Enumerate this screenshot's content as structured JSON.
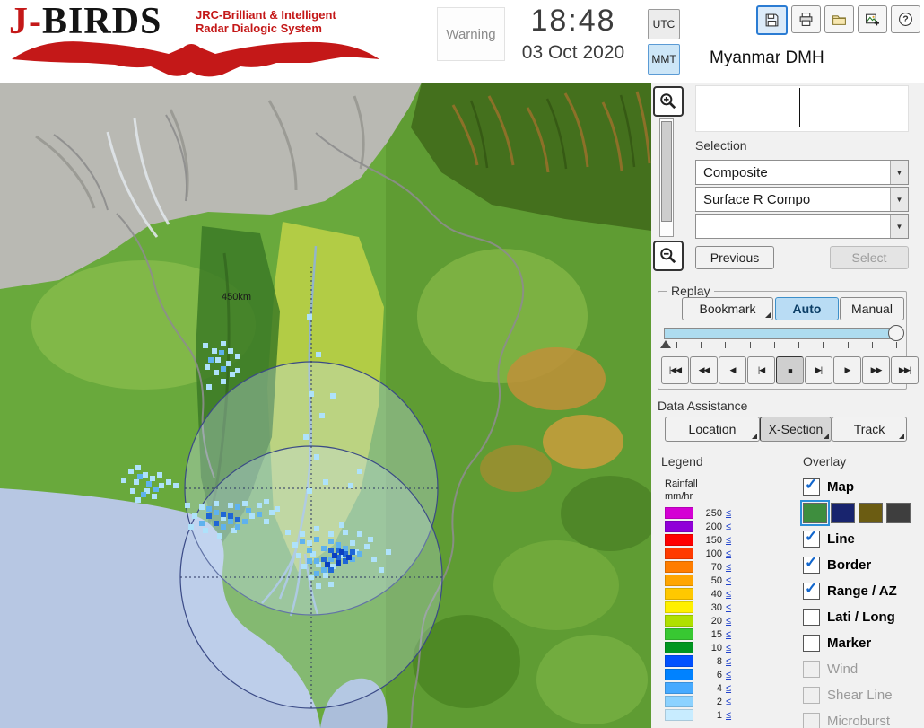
{
  "brand": {
    "logo_red_color": "#c41818",
    "accent_blue": "#2b7cd3"
  },
  "header": {
    "logo_title_red": "J-",
    "logo_title_dark": "BIRDS",
    "logo_sub1": "JRC-Brilliant & Intelligent",
    "logo_sub2": "Radar  Dialogic  System",
    "warning_label": "Warning",
    "time": "18:48",
    "date": "03 Oct 2020",
    "utc_label": "UTC",
    "mmt_label": "MMT",
    "timezone_selected": "MMT",
    "station_title": "Myanmar DMH"
  },
  "toolbar": {
    "icons": [
      "save",
      "print",
      "folder-open",
      "export-image",
      "help"
    ]
  },
  "selection": {
    "label": "Selection",
    "combo1": "Composite",
    "combo2": "Surface R Compo",
    "combo3": "",
    "previous": "Previous",
    "select": "Select"
  },
  "replay": {
    "title": "Replay",
    "bookmark": "Bookmark",
    "auto": "Auto",
    "manual": "Manual",
    "mode_selected": "Auto",
    "slider_position": "100%",
    "playback": [
      "|◀◀",
      "◀◀",
      "◀",
      "|◀",
      "■",
      "▶|",
      "▶",
      "▶▶",
      "▶▶|"
    ],
    "playback_pressed": "■"
  },
  "data_assistance": {
    "label": "Data Assistance",
    "location": "Location",
    "xsection": "X-Section",
    "track": "Track",
    "pressed": "X-Section"
  },
  "legend": {
    "title": "Legend",
    "unit1": "Rainfall",
    "unit2": "mm/hr",
    "lte": "≤",
    "rows": [
      {
        "value": "250",
        "color": "#d400d4"
      },
      {
        "value": "200",
        "color": "#9000d8"
      },
      {
        "value": "150",
        "color": "#ff0000"
      },
      {
        "value": "100",
        "color": "#ff3a00"
      },
      {
        "value": "70",
        "color": "#ff7d00"
      },
      {
        "value": "50",
        "color": "#ffa500"
      },
      {
        "value": "40",
        "color": "#ffc800"
      },
      {
        "value": "30",
        "color": "#fff000"
      },
      {
        "value": "20",
        "color": "#b0e000"
      },
      {
        "value": "15",
        "color": "#38c832"
      },
      {
        "value": "10",
        "color": "#009620"
      },
      {
        "value": "8",
        "color": "#0050ff"
      },
      {
        "value": "6",
        "color": "#0082ff"
      },
      {
        "value": "4",
        "color": "#46aaff"
      },
      {
        "value": "2",
        "color": "#8cd2ff"
      },
      {
        "value": "1",
        "color": "#c8ecff"
      }
    ]
  },
  "overlay": {
    "title": "Overlay",
    "items": [
      {
        "label": "Map",
        "checked": true,
        "disabled": false
      },
      {
        "label": "Line",
        "checked": true,
        "disabled": false
      },
      {
        "label": "Border",
        "checked": true,
        "disabled": false
      },
      {
        "label": "Range / AZ",
        "checked": true,
        "disabled": false
      },
      {
        "label": "Lati / Long",
        "checked": false,
        "disabled": false
      },
      {
        "label": "Marker",
        "checked": false,
        "disabled": false
      },
      {
        "label": "Wind",
        "checked": false,
        "disabled": true
      },
      {
        "label": "Shear Line",
        "checked": false,
        "disabled": true
      },
      {
        "label": "Microburst",
        "checked": false,
        "disabled": true
      }
    ],
    "map_styles": [
      "#3e8e3e",
      "#18246e",
      "#6b5c12",
      "#3e3e3e"
    ],
    "map_style_selected": 0
  },
  "map": {
    "range_label": "450km"
  }
}
